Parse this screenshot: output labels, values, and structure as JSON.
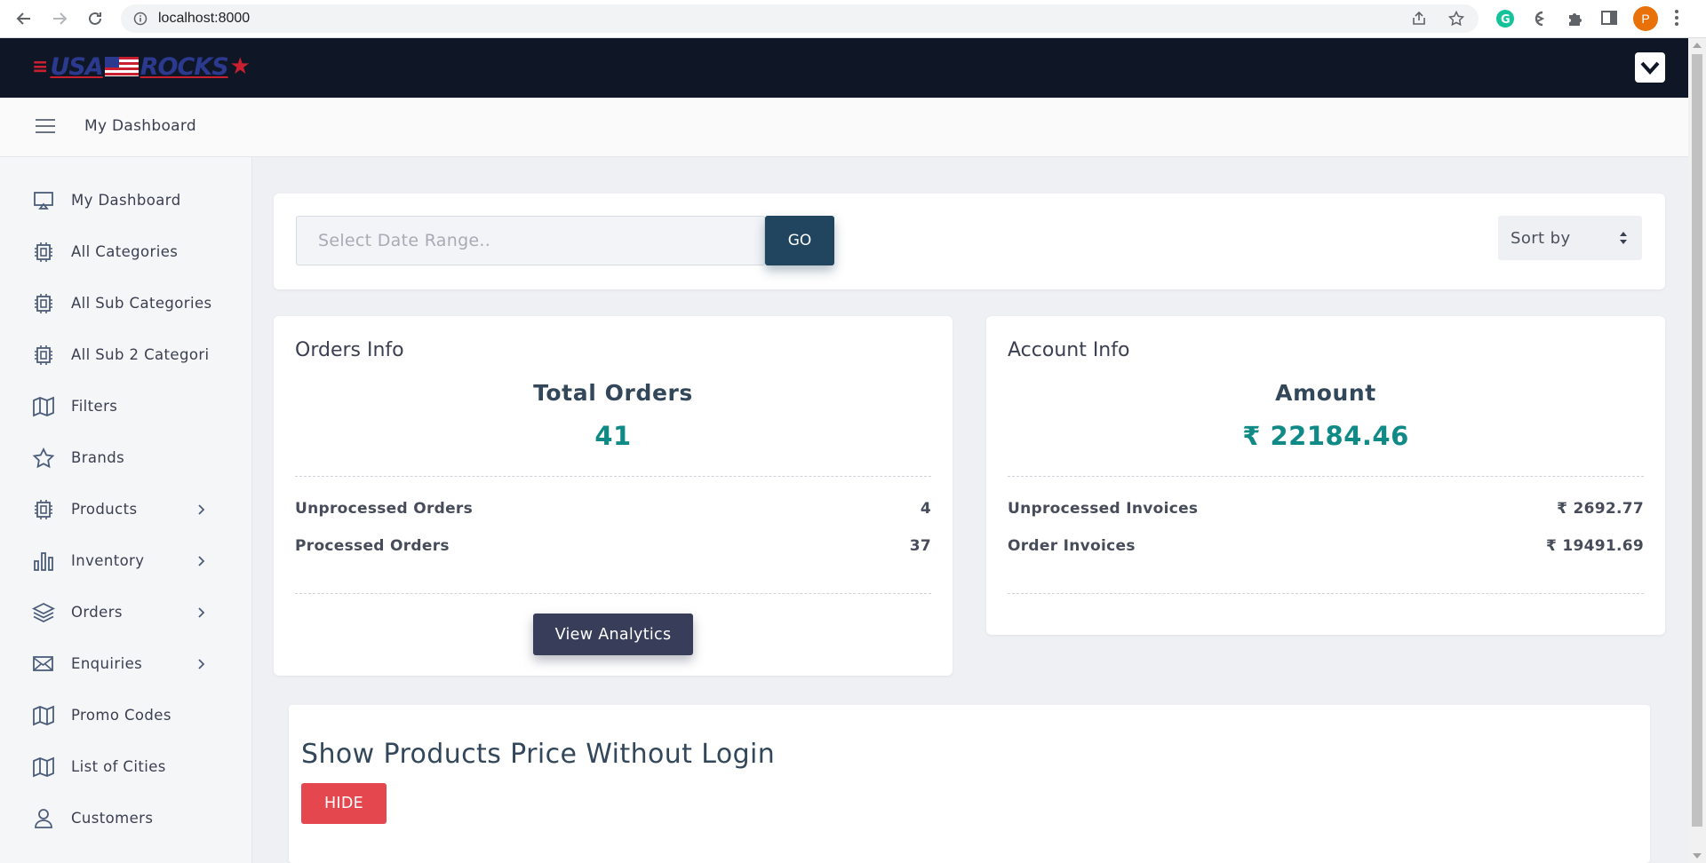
{
  "browser": {
    "url": "localhost:8000",
    "profile_initial": "P"
  },
  "header": {
    "logo_text_left": "USA",
    "logo_text_right": "ROCKS"
  },
  "subheader": {
    "title": "My Dashboard"
  },
  "sidebar": {
    "items": [
      {
        "label": "My Dashboard",
        "icon": "monitor-icon"
      },
      {
        "label": "All Categories",
        "icon": "chip-icon"
      },
      {
        "label": "All Sub Categories",
        "icon": "chip-icon"
      },
      {
        "label": "All Sub 2 Categori",
        "icon": "chip-icon"
      },
      {
        "label": "Filters",
        "icon": "map-icon"
      },
      {
        "label": "Brands",
        "icon": "star-icon"
      },
      {
        "label": "Products",
        "icon": "chip-icon",
        "has_submenu": true
      },
      {
        "label": "Inventory",
        "icon": "bar-chart-icon",
        "has_submenu": true
      },
      {
        "label": "Orders",
        "icon": "layers-icon",
        "has_submenu": true
      },
      {
        "label": "Enquiries",
        "icon": "mail-icon",
        "has_submenu": true
      },
      {
        "label": "Promo Codes",
        "icon": "map-icon"
      },
      {
        "label": "List of Cities",
        "icon": "map-icon"
      },
      {
        "label": "Customers",
        "icon": "user-icon"
      }
    ]
  },
  "filter": {
    "date_placeholder": "Select Date Range..",
    "go_label": "GO",
    "sort_label": "Sort by"
  },
  "orders_info": {
    "title": "Orders Info",
    "heading": "Total Orders",
    "value": "41",
    "rows": [
      {
        "label": "Unprocessed Orders",
        "value": "4"
      },
      {
        "label": "Processed Orders",
        "value": "37"
      }
    ],
    "button_label": "View Analytics"
  },
  "account_info": {
    "title": "Account Info",
    "heading": "Amount",
    "value": "₹ 22184.46",
    "rows": [
      {
        "label": "Unprocessed Invoices",
        "value": "₹ 2692.77"
      },
      {
        "label": "Order Invoices",
        "value": "₹ 19491.69"
      }
    ]
  },
  "price_section": {
    "title": "Show Products Price Without Login",
    "button_label": "HIDE"
  },
  "colors": {
    "header_bg": "#0f1726",
    "accent_teal": "#108a86",
    "go_button": "#21445f",
    "analytics_button": "#383d5a",
    "hide_button": "#e5474f"
  }
}
